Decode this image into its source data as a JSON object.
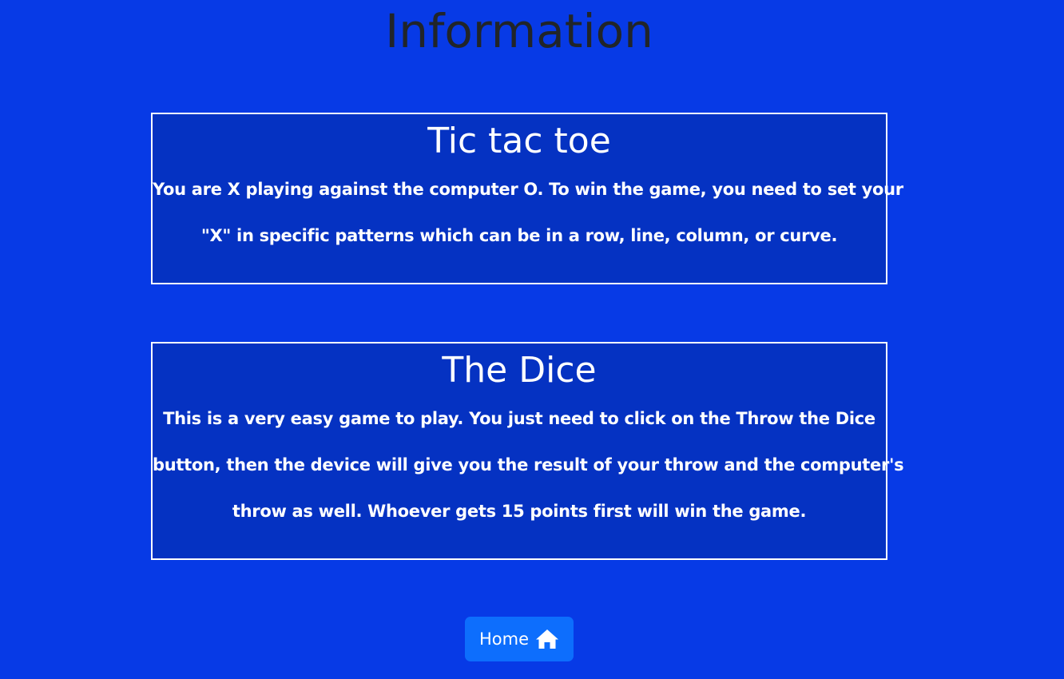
{
  "page": {
    "title": "Information"
  },
  "cards": [
    {
      "title": "Tic tac toe",
      "lines": [
        "You are X playing against the computer O. To win the game, you need to set your",
        "\"X\" in specific patterns which can be in a row, line, column, or curve."
      ]
    },
    {
      "title": "The Dice",
      "lines": [
        "This is a very easy game to play. You just need to click on the Throw the Dice",
        "button, then the device will give you the result of your throw and the computer's",
        "throw as well. Whoever gets 15 points first will win the game."
      ]
    }
  ],
  "home_button": {
    "label": "Home",
    "icon": "home-icon"
  },
  "colors": {
    "background": "#073ae6",
    "card_background": "#0532c2",
    "card_border": "#ffffff",
    "title_text": "#212529",
    "button": "#0d6efd"
  }
}
